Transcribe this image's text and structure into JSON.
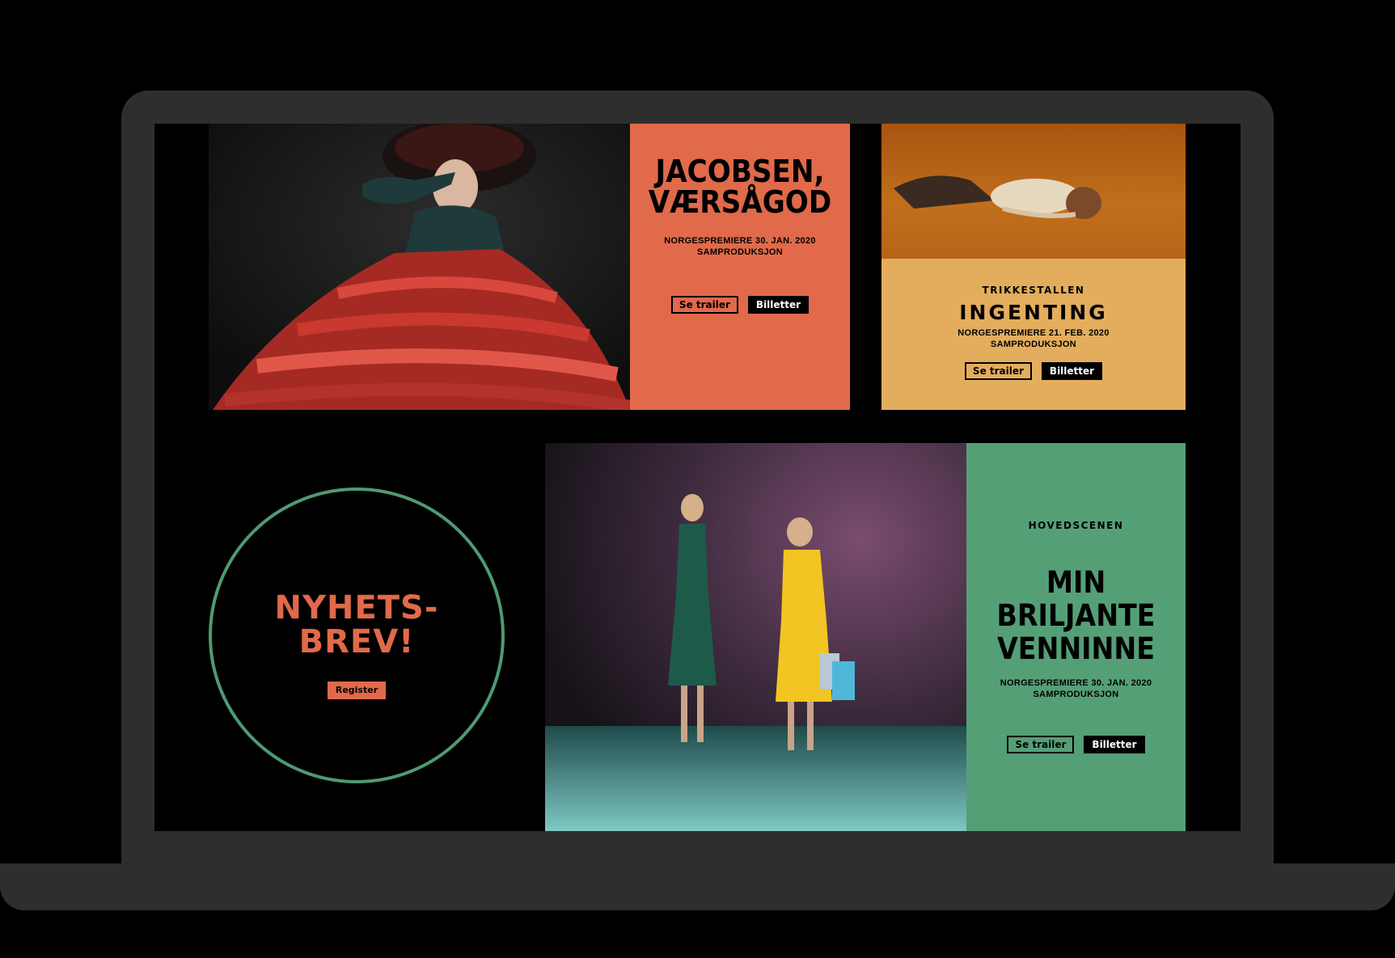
{
  "colors": {
    "frame": "#2e2e2e",
    "screen_bg": "#000000",
    "coral": "#e06a4a",
    "mustard": "#e3ad5d",
    "green": "#559f77",
    "circle_stroke": "#4e9a73"
  },
  "cards": [
    {
      "title_line1": "JACOBSEN,",
      "title_line2": "VÆRSÅGOD",
      "meta_line1": "NORGESPREMIERE 30. JAN. 2020",
      "meta_line2": "SAMPRODUKSJON",
      "trailer_label": "Se trailer",
      "tickets_label": "Billetter"
    },
    {
      "kicker": "TRIKKESTALLEN",
      "title": "INGENTING",
      "meta_line1": "NORGESPREMIERE 21. FEB. 2020",
      "meta_line2": "SAMPRODUKSJON",
      "trailer_label": "Se trailer",
      "tickets_label": "Billetter"
    },
    {
      "kicker": "HOVEDSCENEN",
      "title_line1": "MIN",
      "title_line2": "BRILJANTE",
      "title_line3": "VENNINNE",
      "meta_line1": "NORGESPREMIERE 30. JAN. 2020",
      "meta_line2": "SAMPRODUKSJON",
      "trailer_label": "Se trailer",
      "tickets_label": "Billetter"
    }
  ],
  "newsletter": {
    "title_line1": "NYHETS-",
    "title_line2": "BREV!",
    "button_label": "Register"
  }
}
